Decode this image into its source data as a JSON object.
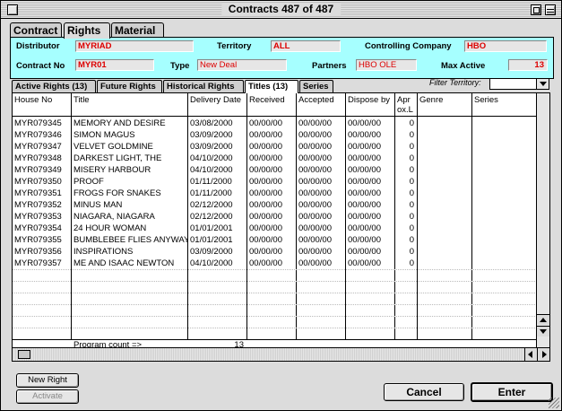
{
  "window": {
    "title": "Contracts 487 of 487"
  },
  "tabs_top": [
    {
      "label": "Contract",
      "active": false
    },
    {
      "label": "Rights",
      "active": true
    },
    {
      "label": "Material",
      "active": false
    }
  ],
  "header": {
    "distributor_label": "Distributor",
    "distributor_value": "MYRIAD",
    "territory_label": "Territory",
    "territory_value": "ALL",
    "controlling_label": "Controlling Company",
    "controlling_value": "HBO",
    "contract_no_label": "Contract No",
    "contract_no_value": "MYR01",
    "type_label": "Type",
    "type_value": "New Deal",
    "partners_label": "Partners",
    "partners_value": "HBO OLE",
    "max_active_label": "Max Active",
    "max_active_value": "13",
    "value_color": "#dd0000",
    "panel_color": "#a6ffff"
  },
  "subtabs": [
    {
      "label": "Active Rights (13)",
      "active": false
    },
    {
      "label": "Future Rights",
      "active": false
    },
    {
      "label": "Historical Rights",
      "active": false
    },
    {
      "label": "Titles (13)",
      "active": true
    },
    {
      "label": "Series",
      "active": false
    }
  ],
  "filter": {
    "label": "Filter Territory:",
    "value": ""
  },
  "table": {
    "columns": [
      {
        "label": "House No"
      },
      {
        "label": "Title"
      },
      {
        "label": "Delivery Date"
      },
      {
        "label": "Received"
      },
      {
        "label": "Accepted"
      },
      {
        "label": "Dispose by"
      },
      {
        "label": "Apr ox.L"
      },
      {
        "label": "Genre"
      },
      {
        "label": "Series"
      }
    ],
    "rows": [
      [
        "MYR079345",
        "MEMORY AND DESIRE",
        "03/08/2000",
        "00/00/00",
        "00/00/00",
        "00/00/00",
        "0",
        "",
        ""
      ],
      [
        "MYR079346",
        "SIMON MAGUS",
        "03/09/2000",
        "00/00/00",
        "00/00/00",
        "00/00/00",
        "0",
        "",
        ""
      ],
      [
        "MYR079347",
        "VELVET GOLDMINE",
        "03/09/2000",
        "00/00/00",
        "00/00/00",
        "00/00/00",
        "0",
        "",
        ""
      ],
      [
        "MYR079348",
        "DARKEST LIGHT, THE",
        "04/10/2000",
        "00/00/00",
        "00/00/00",
        "00/00/00",
        "0",
        "",
        ""
      ],
      [
        "MYR079349",
        "MISERY HARBOUR",
        "04/10/2000",
        "00/00/00",
        "00/00/00",
        "00/00/00",
        "0",
        "",
        ""
      ],
      [
        "MYR079350",
        "PROOF",
        "01/11/2000",
        "00/00/00",
        "00/00/00",
        "00/00/00",
        "0",
        "",
        ""
      ],
      [
        "MYR079351",
        "FROGS FOR SNAKES",
        "01/11/2000",
        "00/00/00",
        "00/00/00",
        "00/00/00",
        "0",
        "",
        ""
      ],
      [
        "MYR079352",
        "MINUS MAN",
        "02/12/2000",
        "00/00/00",
        "00/00/00",
        "00/00/00",
        "0",
        "",
        ""
      ],
      [
        "MYR079353",
        "NIAGARA, NIAGARA",
        "02/12/2000",
        "00/00/00",
        "00/00/00",
        "00/00/00",
        "0",
        "",
        ""
      ],
      [
        "MYR079354",
        "24 HOUR WOMAN",
        "01/01/2001",
        "00/00/00",
        "00/00/00",
        "00/00/00",
        "0",
        "",
        ""
      ],
      [
        "MYR079355",
        "BUMBLEBEE FLIES ANYWAY,",
        "01/01/2001",
        "00/00/00",
        "00/00/00",
        "00/00/00",
        "0",
        "",
        ""
      ],
      [
        "MYR079356",
        "INSPIRATIONS",
        "03/09/2000",
        "00/00/00",
        "00/00/00",
        "00/00/00",
        "0",
        "",
        ""
      ],
      [
        "MYR079357",
        "ME AND ISAAC NEWTON",
        "04/10/2000",
        "00/00/00",
        "00/00/00",
        "00/00/00",
        "0",
        "",
        ""
      ]
    ],
    "footer_label": "Program count =>",
    "footer_value": "13"
  },
  "buttons": {
    "new_right": "New Right",
    "activate": "Activate",
    "cancel": "Cancel",
    "enter": "Enter"
  }
}
